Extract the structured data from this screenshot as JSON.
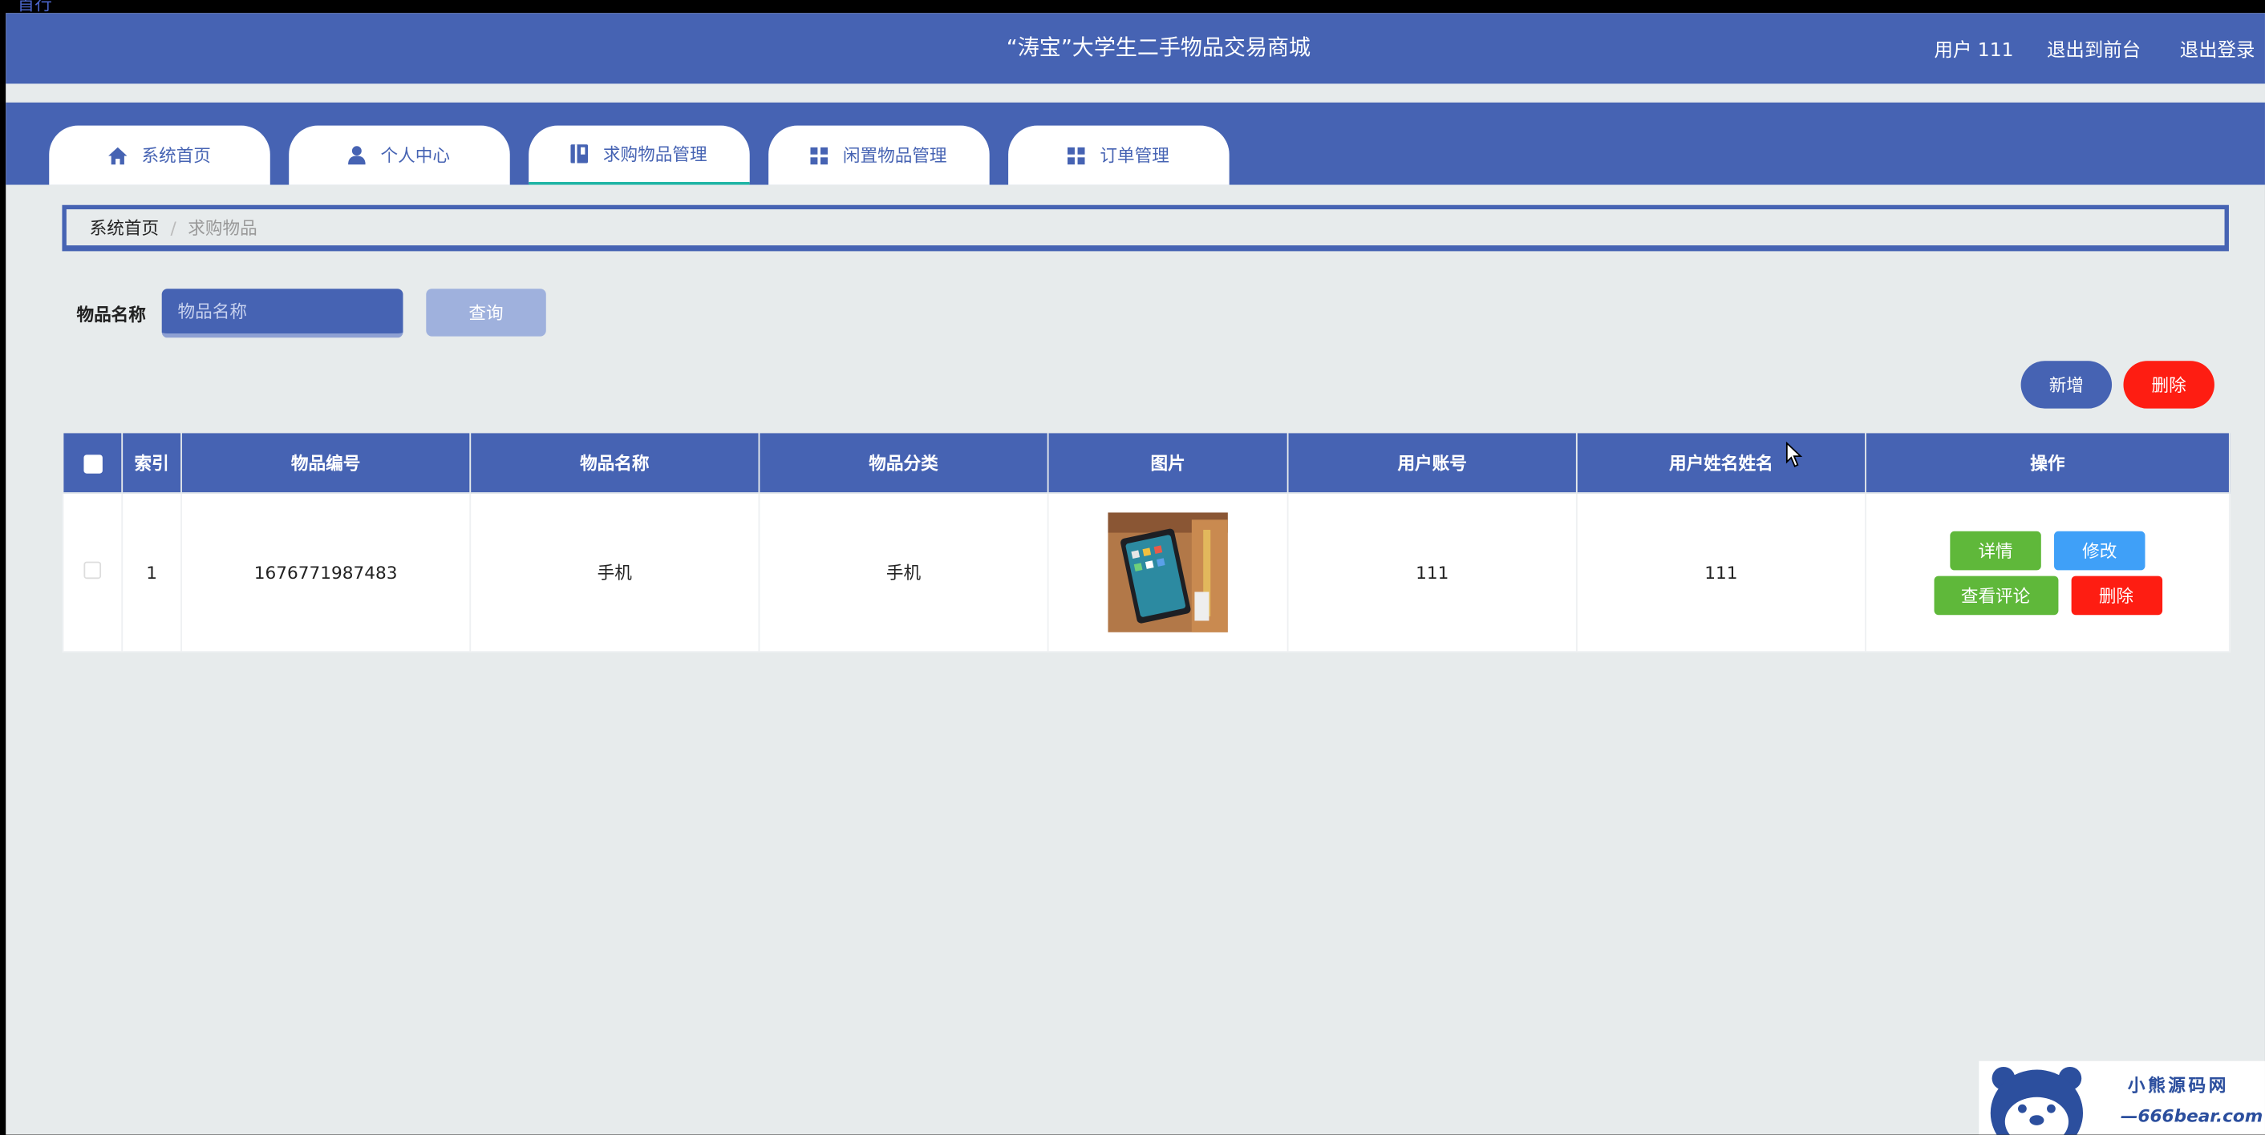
{
  "top_strip": {
    "clipped_text": "首行"
  },
  "header": {
    "title": "“涛宝”大学生二手物品交易商城",
    "user": "用户 111",
    "back_to_front": "退出到前台",
    "logout": "退出登录"
  },
  "nav": {
    "tabs": [
      {
        "label": "系统首页",
        "icon": "home-icon"
      },
      {
        "label": "个人中心",
        "icon": "user-icon"
      },
      {
        "label": "求购物品管理",
        "icon": "book-icon",
        "active": true
      },
      {
        "label": "闲置物品管理",
        "icon": "grid-icon"
      },
      {
        "label": "订单管理",
        "icon": "grid-icon"
      }
    ]
  },
  "breadcrumb": {
    "home": "系统首页",
    "separator": "/",
    "current": "求购物品"
  },
  "search": {
    "label": "物品名称",
    "placeholder": "物品名称",
    "value": "",
    "query_button": "查询"
  },
  "actions": {
    "add": "新增",
    "delete": "删除"
  },
  "table": {
    "headers": [
      "索引",
      "物品编号",
      "物品名称",
      "物品分类",
      "图片",
      "用户账号",
      "用户姓名姓名",
      "操作"
    ],
    "rows": [
      {
        "index": "1",
        "item_no": "1676771987483",
        "item_name": "手机",
        "category": "手机",
        "image": "tablet-photo",
        "account": "111",
        "user_name": "111",
        "ops": {
          "detail": "详情",
          "edit": "修改",
          "comment": "查看评论",
          "delete": "删除"
        }
      }
    ]
  },
  "watermark": {
    "line1": "小熊源码网",
    "line2": "—666bear.com—"
  },
  "colors": {
    "primary": "#4663b3",
    "danger": "#fe1d12",
    "success": "#5fb83a",
    "info": "#3fa0f8",
    "background": "#e7ebec"
  }
}
